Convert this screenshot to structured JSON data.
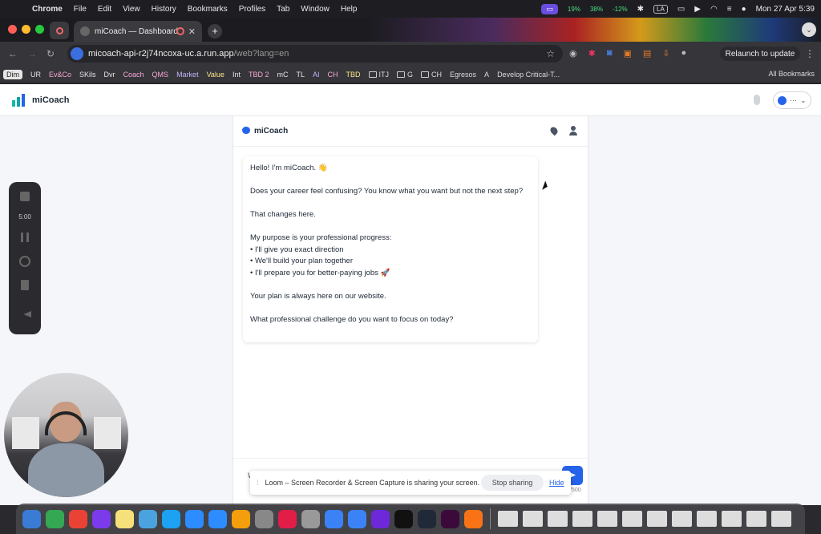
{
  "menubar": {
    "app": "Chrome",
    "items": [
      "File",
      "Edit",
      "View",
      "History",
      "Bookmarks",
      "Profiles",
      "Tab",
      "Window",
      "Help"
    ],
    "stat1": "19%",
    "stat2": "38%",
    "stat3": "-12%",
    "lang": "LA",
    "datetime": "Mon 27 Apr  5:39"
  },
  "browser": {
    "tab_title": "miCoach — Dashboard",
    "url_host": "micoach-api-r2j74ncoxa-uc.a.run.app",
    "url_path": "/web?lang=en",
    "relaunch": "Relaunch to update",
    "bookmarks": [
      "Dim",
      "UR",
      "Ev&Co",
      "SKils",
      "Dvr",
      "Coach",
      "QMS",
      "Market",
      "Value",
      "Int",
      "TBD 2",
      "mC",
      "TL",
      "AI",
      "CH",
      "TBD",
      "ITJ",
      "G",
      "CH",
      "Egresos",
      "A",
      "Develop Critical-T..."
    ],
    "bookmark_colors": [
      "#222",
      "#e6e6e6",
      "#f9a8d4",
      "#e6e6e6",
      "#e6e6e6",
      "#f9a8d4",
      "#f9a8d4",
      "#c4b5fd",
      "#fde68a",
      "#e6e6e6",
      "#f9a8d4",
      "#e6e6e6",
      "#e6e6e6",
      "#c4b5fd",
      "#f9a8d4",
      "#fde68a",
      "#ddd",
      "#ddd",
      "#ddd",
      "#ddd",
      "#ddd",
      "#ddd"
    ],
    "all_bookmarks": "All Bookmarks"
  },
  "app": {
    "name": "miCoach",
    "user_menu_dots": "···",
    "chat_title": "miCoach",
    "message": "Hello! I'm miCoach. 👋\n\nDoes your career feel confusing? You know what you want but not the next step?\n\nThat changes here.\n\nMy purpose is your professional progress:\n• I'll give you exact direction\n• We'll build your plan together\n• I'll prepare you for better-paying jobs 🚀\n\nYour plan is always here on our website.\n\nWhat professional challenge do you want to focus on today?",
    "input_placeholder_fragment": "W",
    "char_counter": "/500",
    "accent": "#2563eb"
  },
  "recorder": {
    "time": "5:00"
  },
  "loom": {
    "message": "Loom – Screen Recorder & Screen Capture is sharing your screen.",
    "stop": "Stop sharing",
    "hide": "Hide"
  },
  "dock": {
    "icon_colors": [
      "#3a7bd5",
      "#34a853",
      "#ea4335",
      "#7c3aed",
      "#f5e07a",
      "#4aa3df",
      "#1da1f2",
      "#2d8cff",
      "#2d8cff",
      "#f59e0b",
      "#888",
      "#e11d48",
      "#999",
      "#3b82f6",
      "#3b82f6",
      "#6d28d9",
      "#111",
      "#1f2937",
      "#3b0a3a",
      "#f97316"
    ]
  }
}
